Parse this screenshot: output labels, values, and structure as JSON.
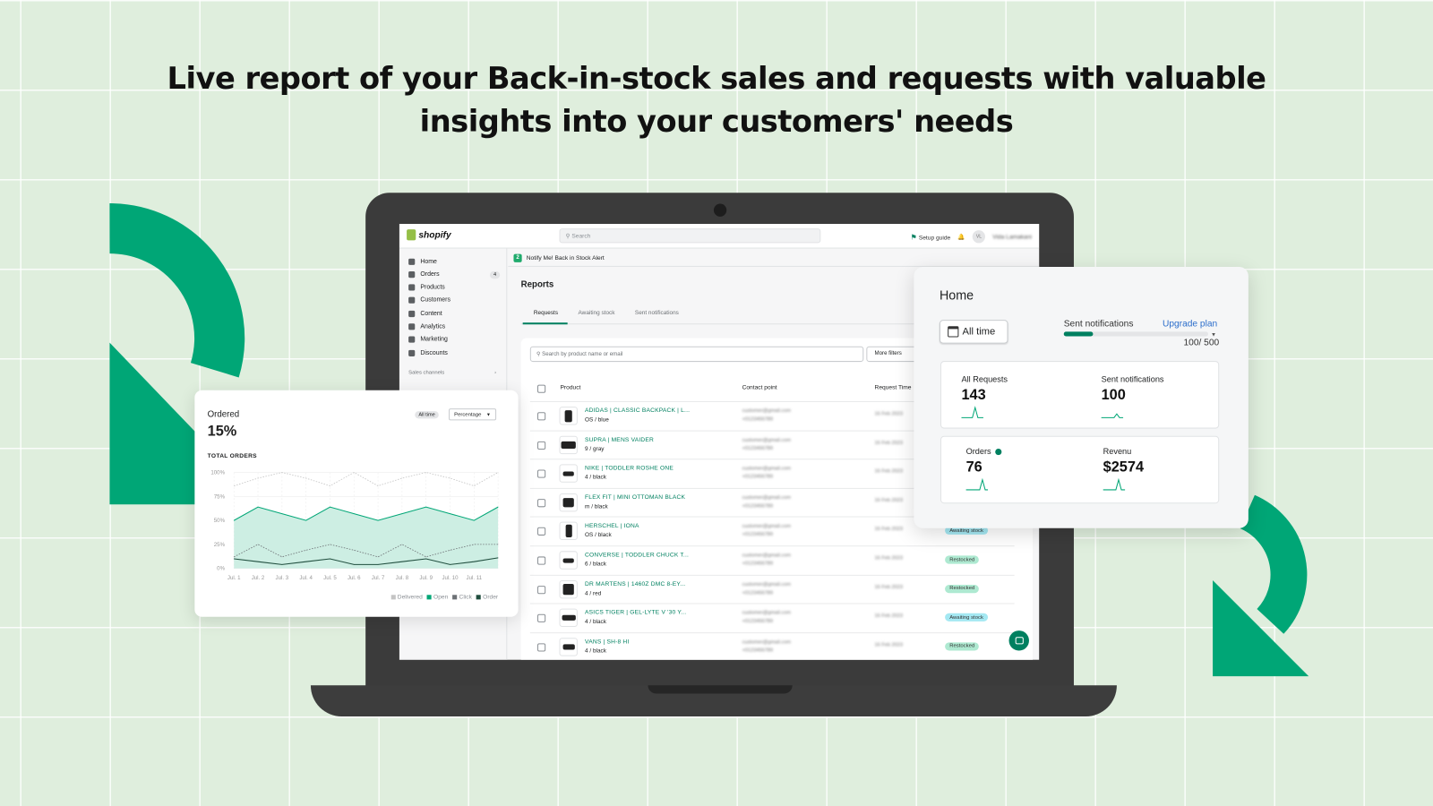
{
  "headline": {
    "line1": "Live report of your Back-in-stock sales and requests with valuable",
    "line2": "insights into your customers' needs"
  },
  "colors": {
    "brand_green": "#00a676",
    "shopify_green": "#008060",
    "background": "#dfeedd"
  },
  "topbar": {
    "logo": "shopify",
    "search_placeholder": "Search",
    "setup_guide": "Setup guide",
    "avatar_initials": "VL",
    "user_name": "Vida Lamakani"
  },
  "sidebar": {
    "items": [
      {
        "label": "Home",
        "icon": "home-icon"
      },
      {
        "label": "Orders",
        "icon": "orders-icon",
        "badge": "4"
      },
      {
        "label": "Products",
        "icon": "tag-icon"
      },
      {
        "label": "Customers",
        "icon": "person-icon"
      },
      {
        "label": "Content",
        "icon": "content-icon"
      },
      {
        "label": "Analytics",
        "icon": "bar-chart-icon"
      },
      {
        "label": "Marketing",
        "icon": "target-icon"
      },
      {
        "label": "Discounts",
        "icon": "discount-icon"
      }
    ],
    "section": "Sales channels"
  },
  "app": {
    "name": "Notify Me! Back in Stock Alert"
  },
  "reports": {
    "title": "Reports",
    "tabs": [
      "Requests",
      "Awaiting stock",
      "Sent notifications"
    ],
    "active_tab": 0,
    "search_placeholder": "Search by product name or email",
    "more_filters": "More filters",
    "columns": [
      "Product",
      "Contact point",
      "Request Time"
    ],
    "rows": [
      {
        "name": "ADIDAS | CLASSIC BACKPACK | L...",
        "variant": "OS / blue",
        "status": ""
      },
      {
        "name": "SUPRA | MENS VAIDER",
        "variant": "9 / gray",
        "status": ""
      },
      {
        "name": "NIKE | TODDLER ROSHE ONE",
        "variant": "4 / black",
        "status": ""
      },
      {
        "name": "FLEX FIT | MINI OTTOMAN BLACK",
        "variant": "m / black",
        "status": ""
      },
      {
        "name": "HERSCHEL | IONA",
        "variant": "OS / black",
        "status": "Awaiting stock"
      },
      {
        "name": "CONVERSE | TODDLER CHUCK T...",
        "variant": "6 / black",
        "status": "Restocked"
      },
      {
        "name": "DR MARTENS | 1460Z DMC 8-EY...",
        "variant": "4 / red",
        "status": "Restocked"
      },
      {
        "name": "ASICS TIGER | GEL-LYTE V '30 Y...",
        "variant": "4 / black",
        "status": "Awaiting stock"
      },
      {
        "name": "VANS | SH-8 HI",
        "variant": "4 / black",
        "status": "Restocked"
      }
    ]
  },
  "home": {
    "title": "Home",
    "date_range": "All time",
    "sent_label": "Sent notifications",
    "upgrade": "Upgrade plan",
    "quota_text": "100/ 500",
    "quota_fraction": 0.2,
    "stats": [
      {
        "label": "All Requests",
        "value": "143"
      },
      {
        "label": "Sent notifications",
        "value": "100"
      },
      {
        "label": "Orders",
        "value": "76"
      },
      {
        "label": "Revenu",
        "value": "$2574"
      }
    ]
  },
  "ordered": {
    "title": "Ordered",
    "value": "15%",
    "range": "All time",
    "mode": "Percentage",
    "subtitle": "TOTAL ORDERS"
  },
  "chart_data": {
    "type": "area",
    "title": "TOTAL ORDERS",
    "categories": [
      "Jul. 1",
      "Jul. 2",
      "Jul. 3",
      "Jul. 4",
      "Jul. 5",
      "Jul. 6",
      "Jul. 7",
      "Jul. 8",
      "Jul. 9",
      "Jul. 10",
      "Jul. 11",
      ""
    ],
    "yticks": [
      "0%",
      "25%",
      "50%",
      "75%",
      "100%"
    ],
    "ylim": [
      0,
      100
    ],
    "legend_position": "bottom-right",
    "grid": true,
    "series": [
      {
        "name": "Delivered",
        "color": "#c4c4c4",
        "style": "dotted",
        "values": [
          86,
          94,
          100,
          94,
          86,
          100,
          86,
          94,
          100,
          94,
          86,
          100
        ]
      },
      {
        "name": "Open",
        "color": "#00a676",
        "style": "area",
        "values": [
          50,
          64,
          57,
          50,
          64,
          57,
          50,
          57,
          64,
          57,
          50,
          64
        ]
      },
      {
        "name": "Click",
        "color": "#6d7175",
        "style": "dotted",
        "values": [
          12,
          25,
          12,
          19,
          25,
          19,
          12,
          25,
          12,
          19,
          25,
          25
        ]
      },
      {
        "name": "Order",
        "color": "#1f4d3d",
        "style": "line",
        "values": [
          10,
          7,
          4,
          7,
          10,
          4,
          4,
          7,
          10,
          4,
          7,
          11
        ]
      }
    ]
  }
}
